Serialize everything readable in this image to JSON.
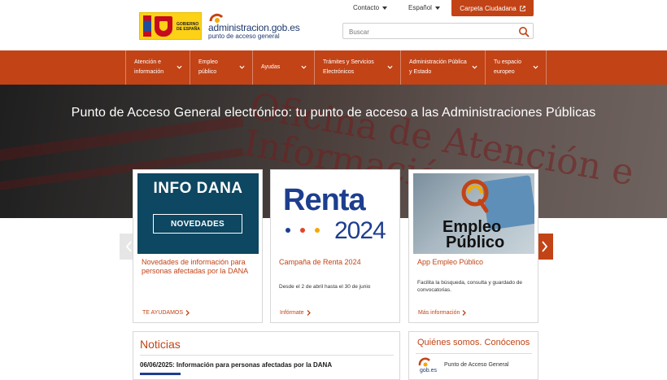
{
  "header": {
    "gov_logo_text": [
      "GOBIERNO",
      "DE ESPAÑA"
    ],
    "portal_logo_line1_a": "administracion",
    "portal_logo_line1_b": ".gob.es",
    "portal_logo_line2": "punto de acceso general",
    "contact_label": "Contacto",
    "language_label": "Español",
    "carpeta_label": "Carpeta Ciudadana",
    "search_placeholder": "Buscar"
  },
  "nav": {
    "items": [
      {
        "line1": "Atención e",
        "line2": "información"
      },
      {
        "line1": "Empleo",
        "line2": "público"
      },
      {
        "line1": "Ayudas",
        "line2": ""
      },
      {
        "line1": "Trámites y Servicios",
        "line2": "Electrónicos"
      },
      {
        "line1": "Administración Pública",
        "line2": "y Estado"
      },
      {
        "line1": "Tu espacio",
        "line2": "europeo"
      }
    ]
  },
  "hero": {
    "title": "Punto de Acceso General electrónico: tu punto de acceso a las Administraciones Públicas",
    "background_text": "Oficina de Atención e Información"
  },
  "cards": [
    {
      "image_line1": "INFO DANA",
      "image_line2": "NOVEDADES",
      "title": "Novedades de información para personas afectadas por la DANA",
      "description": "",
      "link": "TE AYUDAMOS"
    },
    {
      "image_line1": "Renta",
      "image_line2": "2024",
      "title": "Campaña de Renta 2024",
      "description": "Desde el 2 de abril hasta el 30 de junio",
      "link": "Infórmate"
    },
    {
      "image_line1": "Empleo",
      "image_line2": "Público",
      "title": "App Empleo Público",
      "description": "Facilita la búsqueda, consulta y guardado de convocatorias.",
      "link": "Más información"
    }
  ],
  "noticias": {
    "title": "Noticias",
    "headline": "06/06/2025: Información para personas afectadas por la DANA"
  },
  "quienes": {
    "title": "Quiénes somos. Conócenos",
    "logo_text": "gob.es",
    "item_label": "Punto de Acceso General"
  },
  "colors": {
    "brand_orange": "#c24316",
    "brand_navy": "#1d3e8f",
    "dana_teal": "#0d4761"
  },
  "icons": [
    "external-link-icon",
    "search-icon",
    "chevron-down-icon",
    "chevron-left-icon",
    "chevron-right-icon"
  ]
}
